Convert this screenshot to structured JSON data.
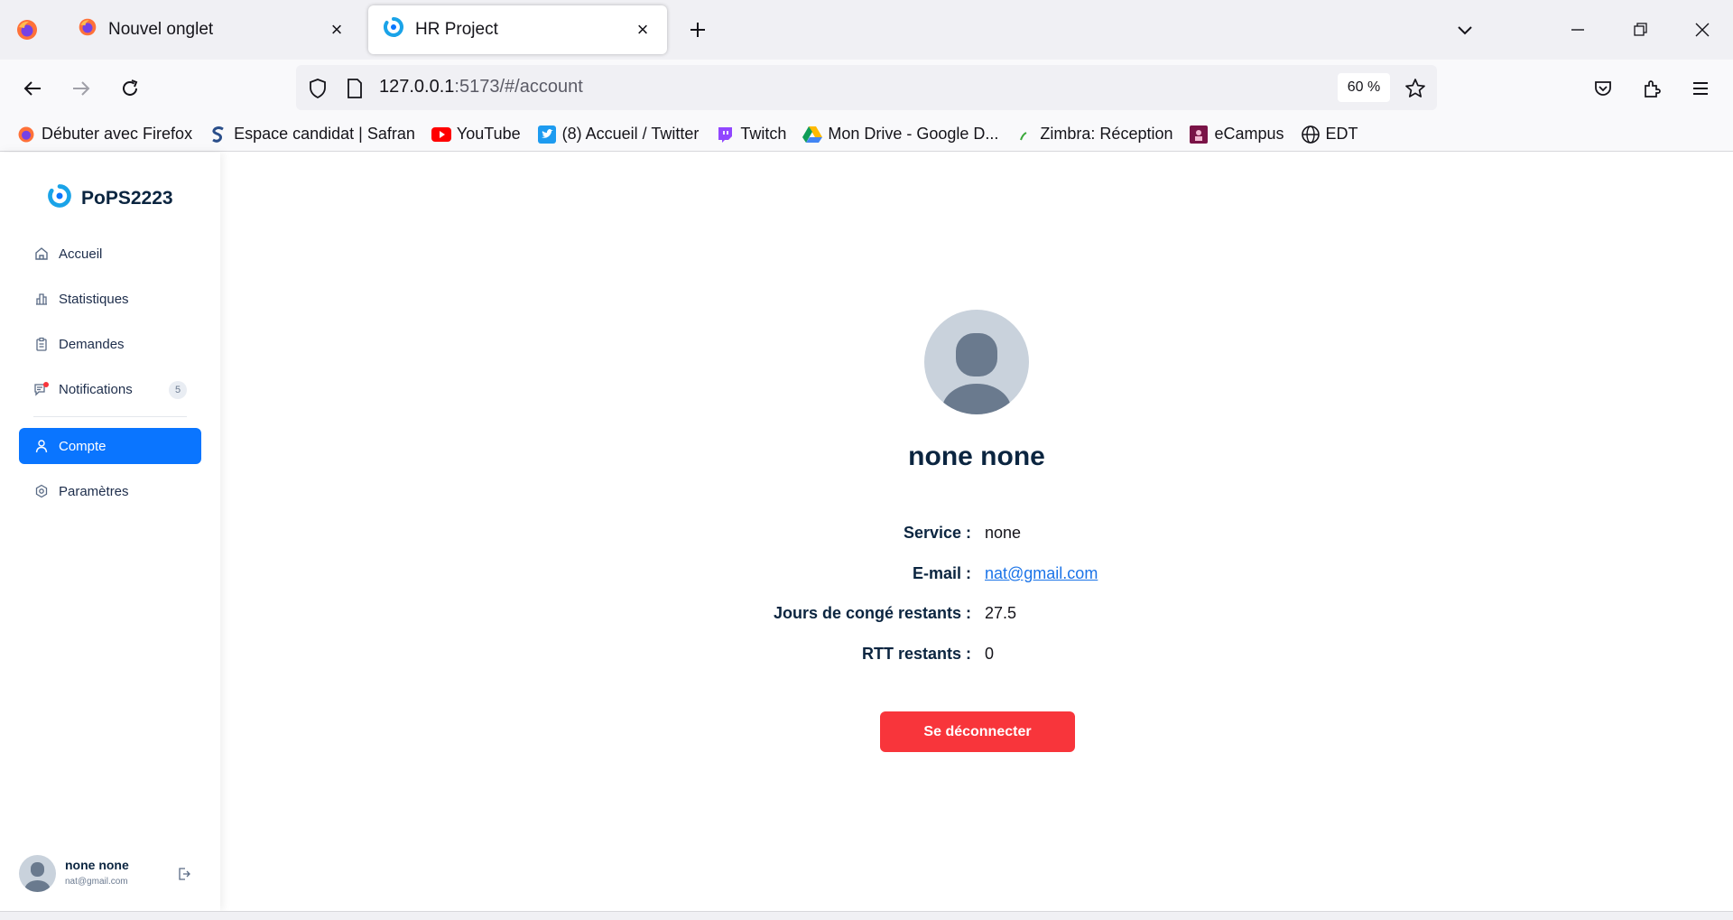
{
  "browser": {
    "tabs": [
      {
        "title": "Nouvel onglet"
      },
      {
        "title": "HR Project"
      }
    ],
    "url_host": "127.0.0.1",
    "url_rest": ":5173/#/account",
    "zoom": "60 %",
    "bookmarks": [
      {
        "label": "Débuter avec Firefox"
      },
      {
        "label": "Espace candidat | Safran"
      },
      {
        "label": "YouTube"
      },
      {
        "label": "(8) Accueil / Twitter"
      },
      {
        "label": "Twitch"
      },
      {
        "label": "Mon Drive - Google D..."
      },
      {
        "label": "Zimbra: Réception"
      },
      {
        "label": "eCampus"
      },
      {
        "label": "EDT"
      }
    ]
  },
  "sidebar": {
    "brand": "PoPS2223",
    "items": [
      {
        "label": "Accueil"
      },
      {
        "label": "Statistiques"
      },
      {
        "label": "Demandes"
      },
      {
        "label": "Notifications",
        "badge": "5"
      },
      {
        "label": "Compte"
      },
      {
        "label": "Paramètres"
      }
    ],
    "user": {
      "name": "none none",
      "email": "nat@gmail.com"
    }
  },
  "profile": {
    "name": "none none",
    "fields": [
      {
        "label": "Service :",
        "value": "none"
      },
      {
        "label": "E-mail :",
        "value": "nat@gmail.com"
      },
      {
        "label": "Jours de congé restants :",
        "value": "27.5"
      },
      {
        "label": "RTT restants :",
        "value": "0"
      }
    ],
    "logout_label": "Se déconnecter"
  },
  "colors": {
    "accent": "#0a75ff",
    "danger": "#f8353b",
    "heading": "#0b2540",
    "link": "#1a73e8"
  }
}
